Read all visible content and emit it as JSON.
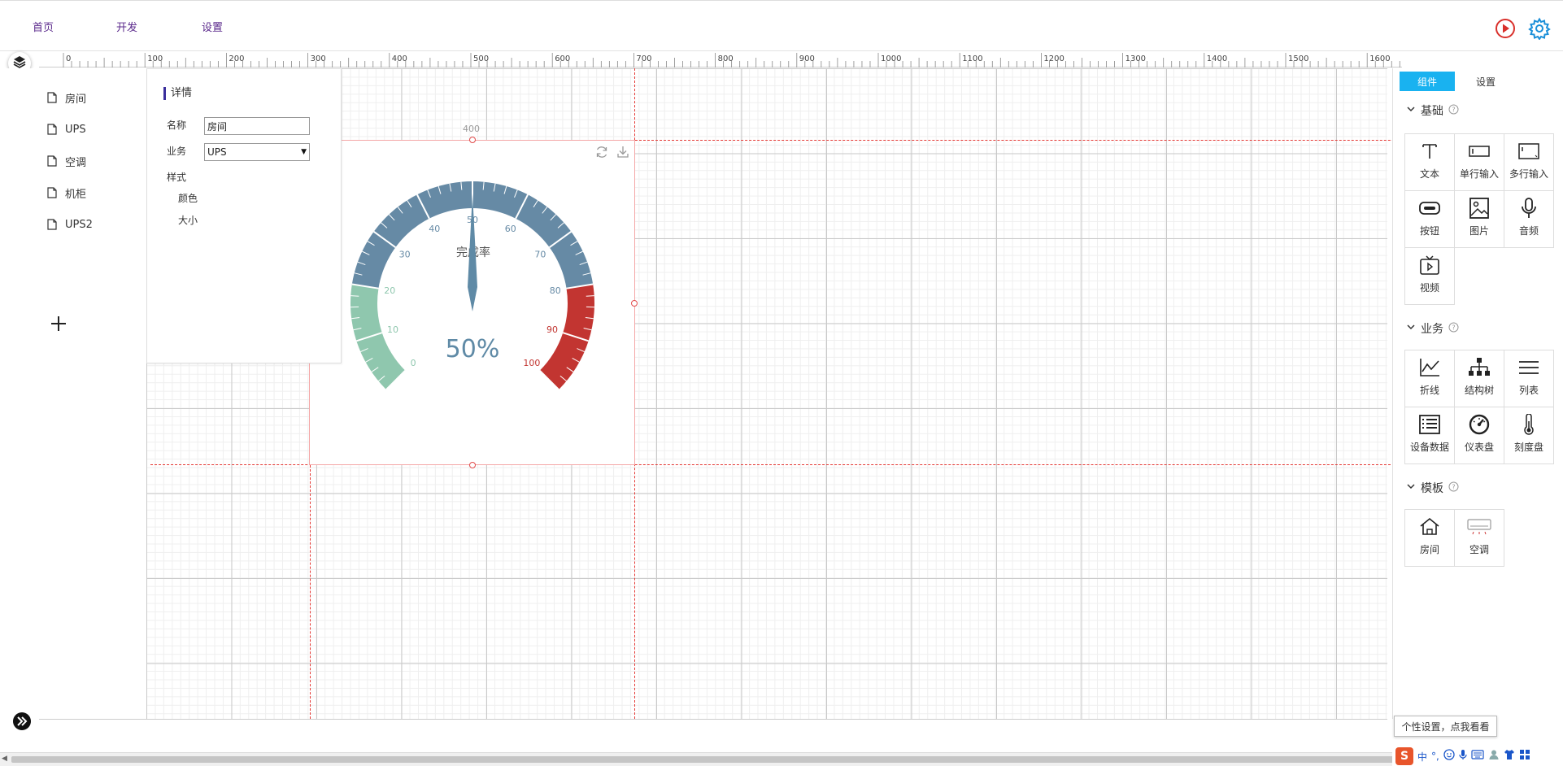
{
  "nav": {
    "home": "首页",
    "develop": "开发",
    "settings": "设置"
  },
  "ruler": {
    "labels": [
      "0",
      "100",
      "200",
      "300",
      "400",
      "500",
      "600",
      "700",
      "800",
      "900",
      "1000",
      "1100",
      "1200",
      "1300",
      "1400",
      "1500",
      "1600"
    ]
  },
  "pages": [
    {
      "label": "房间"
    },
    {
      "label": "UPS"
    },
    {
      "label": "空调"
    },
    {
      "label": "机柜"
    },
    {
      "label": "UPS2"
    }
  ],
  "details": {
    "title": "详情",
    "name_label": "名称",
    "name_value": "房间",
    "business_label": "业务",
    "business_value": "UPS",
    "style_label": "样式",
    "color_label": "颜色",
    "size_label": "大小"
  },
  "widget": {
    "top_label": "400"
  },
  "gauge": {
    "title": "完成率",
    "value_text": "50%",
    "value": 50,
    "min": 0,
    "max": 100,
    "ticks": [
      "0",
      "10",
      "20",
      "30",
      "40",
      "50",
      "60",
      "70",
      "80",
      "90",
      "100"
    ],
    "colors": {
      "low": "#8fc7ae",
      "mid": "#668aa5",
      "high": "#c23531",
      "needle": "#5f8aa6"
    }
  },
  "right_panel": {
    "tabs": {
      "components": "组件",
      "settings": "设置"
    },
    "accent": "#19b2f0",
    "sections": {
      "basic": {
        "title": "基础",
        "items": [
          {
            "label": "文本",
            "icon": "text-icon"
          },
          {
            "label": "单行输入",
            "icon": "single-line-input-icon"
          },
          {
            "label": "多行输入",
            "icon": "multi-line-input-icon"
          },
          {
            "label": "按钮",
            "icon": "button-icon"
          },
          {
            "label": "图片",
            "icon": "image-icon"
          },
          {
            "label": "音频",
            "icon": "microphone-icon"
          },
          {
            "label": "视频",
            "icon": "video-icon"
          }
        ]
      },
      "business": {
        "title": "业务",
        "items": [
          {
            "label": "折线",
            "icon": "line-chart-icon"
          },
          {
            "label": "结构树",
            "icon": "org-tree-icon"
          },
          {
            "label": "列表",
            "icon": "list-icon"
          },
          {
            "label": "设备数据",
            "icon": "device-data-icon"
          },
          {
            "label": "仪表盘",
            "icon": "dashboard-icon"
          },
          {
            "label": "刻度盘",
            "icon": "thermometer-icon"
          }
        ]
      },
      "template": {
        "title": "模板",
        "items": [
          {
            "label": "房间",
            "icon": "house-icon"
          },
          {
            "label": "空调",
            "icon": "air-conditioner-icon"
          }
        ]
      }
    }
  },
  "tooltip": "个性设置，点我看看",
  "tray": {
    "lang": "中"
  }
}
